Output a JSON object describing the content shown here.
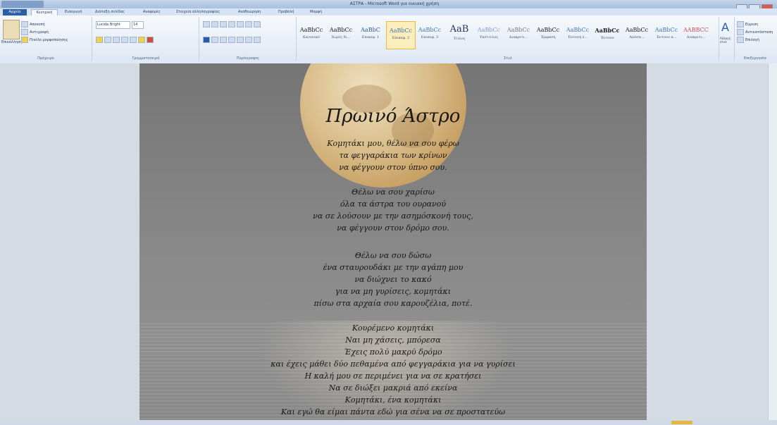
{
  "window": {
    "title": "ΑΣΤΡΑ - Microsoft Word για οικιακή χρήση"
  },
  "tabs": [
    {
      "label": "Αρχείο"
    },
    {
      "label": "Κεντρική"
    },
    {
      "label": "Εισαγωγή"
    },
    {
      "label": "Διάταξη σελίδας"
    },
    {
      "label": "Αναφορές"
    },
    {
      "label": "Στοιχεία αλληλογραφίας"
    },
    {
      "label": "Αναθεώρηση"
    },
    {
      "label": "Προβολή"
    },
    {
      "label": "Μορφή"
    }
  ],
  "ribbon": {
    "clipboard": {
      "paste": "Επικόλληση",
      "cut": "Αποκοπή",
      "copy": "Αντιγραφή",
      "format_painter": "Πινέλο μορφοποίησης",
      "group": "Πρόχειρο"
    },
    "font": {
      "name": "Lucida Bright",
      "size": "14",
      "group": "Γραμματοσειρά"
    },
    "paragraph": {
      "group": "Παράγραφος"
    },
    "styles": {
      "items": [
        {
          "sample": "AaBbCc",
          "name": "Κανονικό"
        },
        {
          "sample": "AaBbCc",
          "name": "Χωρίς δι..."
        },
        {
          "sample": "AaBbC",
          "name": "Επικεφ. 1"
        },
        {
          "sample": "AaBbCc",
          "name": "Επικεφ. 2",
          "selected": true
        },
        {
          "sample": "AaBbCc",
          "name": "Επικεφ. 3"
        },
        {
          "sample": "AaB",
          "name": "Τίτλος"
        },
        {
          "sample": "AaBbCc",
          "name": "Υπότιτλος"
        },
        {
          "sample": "AaBbCc",
          "name": "Διακριτι..."
        },
        {
          "sample": "AaBbCc",
          "name": "Έμφαση"
        },
        {
          "sample": "AaBbCc",
          "name": "Έντονη έ..."
        },
        {
          "sample": "AaBbCc",
          "name": "Έντονο"
        },
        {
          "sample": "AaBbCc",
          "name": "Απόσπ..."
        },
        {
          "sample": "AaBbCc",
          "name": "Έντονο α..."
        },
        {
          "sample": "AABBCC",
          "name": "Διακριτι..."
        }
      ],
      "change": "Αλλαγή στυλ",
      "group": "Στυλ"
    },
    "editing": {
      "find": "Εύρεση",
      "replace": "Αντικατάσταση",
      "select": "Επιλογή",
      "group": "Επεξεργασία"
    }
  },
  "document": {
    "title": "Πρωινό Άστρο",
    "stanzas": [
      [
        "Κομητάκι μου, θέλω να σου φέρω",
        "τα φεγγαράκια των κρίνων",
        "να φέγγουν στον ύπνο σου."
      ],
      [
        "Θέλω να σου χαρίσω",
        "όλα τα άστρα του ουρανού",
        "να σε λούσουν με την ασημόσκονή τους,",
        "να φέγγουν στον δρόμο σου."
      ],
      [
        "Θέλω να σου δώσω",
        "ένα σταυρουδάκι με την αγάπη μου",
        "να διώχνει το κακό",
        "για να μη γυρίσεις, κομητάκι",
        "πίσω στα αρχαία σου καρουζέλια, ποτέ."
      ],
      [
        "Κουρέμενο κομητάκι",
        "Ναι μη χάσεις, μπόρεσα",
        "Έχεις πολύ μακρύ δρόμο",
        "και έχεις μάθει δύο πεθαμένα από φεγγαράκια για να γυρίσει",
        "Η καλή μου σε περιμένει για να σε κρατήσει",
        "Να σε διώξει μακριά από εκείνα",
        "Κομητάκι, ένα κομητάκι",
        "Και εγώ θα είμαι πάντα εδώ για σένα να σε προστατεύω"
      ]
    ]
  }
}
